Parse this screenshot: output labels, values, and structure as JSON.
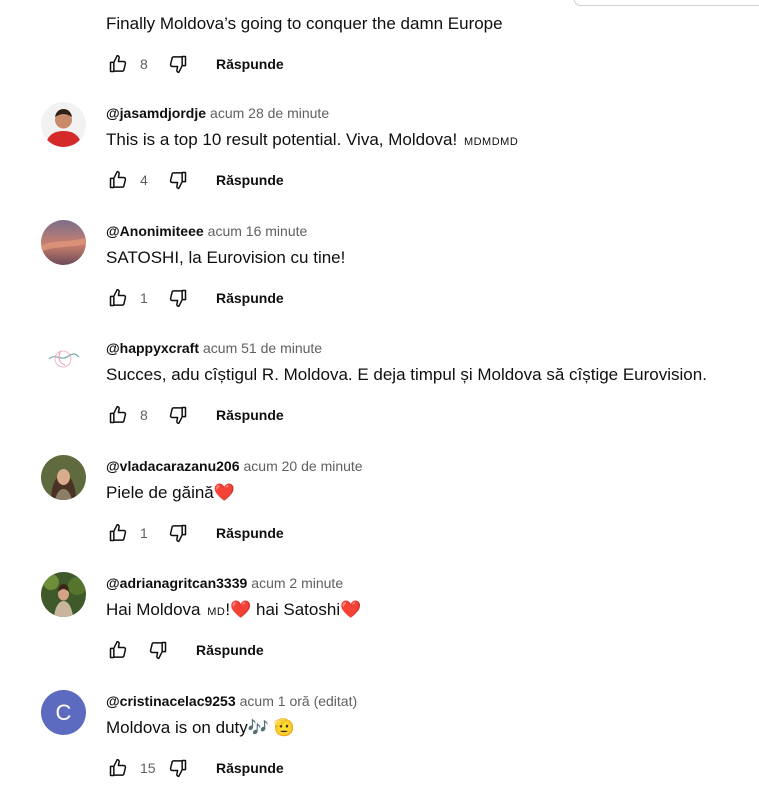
{
  "reply_label": "Răspunde",
  "comments": [
    {
      "author": "",
      "time": "",
      "text": "Finally Moldova’s going to conquer the damn Europe",
      "likes": "8"
    },
    {
      "author": "@jasamdjordje",
      "time": "acum 28 de minute",
      "text": "This is a top 10 result potential. Viva, Moldova!",
      "flag": "MDMDMD",
      "likes": "4"
    },
    {
      "author": "@Anonimiteee",
      "time": "acum 16 minute",
      "text": "SATOSHI, la Eurovision cu tine!",
      "likes": "1"
    },
    {
      "author": "@happyxcraft",
      "time": "acum 51 de minute",
      "text": "Succes, adu cîștigul R. Moldova. E deja timpul și Moldova să cîștige Eurovision.",
      "likes": "8"
    },
    {
      "author": "@vladacarazanu206",
      "time": "acum 20 de minute",
      "text": "Piele de găină",
      "heart": "❤️",
      "likes": "1"
    },
    {
      "author": "@adrianagritcan3339",
      "time": "acum 2 minute",
      "text_a": "Hai Moldova",
      "flag": "MD",
      "text_b": "!",
      "heart": "❤️",
      "text_c": "hai Satoshi",
      "likes": ""
    },
    {
      "author": "@cristinacelac9253",
      "time": "acum 1 oră (editat)",
      "text": "Moldova is on duty",
      "emoji": "🎶",
      "tail": "🫡",
      "avatar_letter": "C",
      "likes": "15"
    }
  ],
  "colors": {
    "letter_avatar": "#5c6bc0",
    "heart": "#e02424"
  }
}
